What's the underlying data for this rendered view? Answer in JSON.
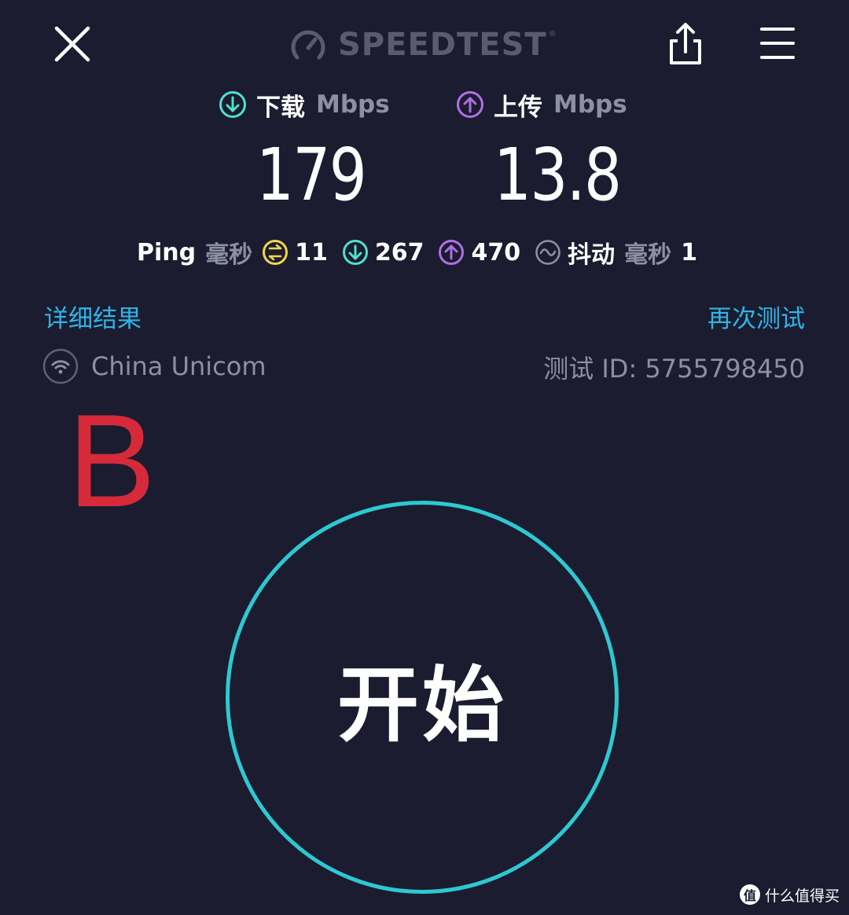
{
  "header": {
    "close_icon": "close-icon",
    "logo_text": "SPEEDTEST",
    "logo_tm": "®",
    "share_icon": "share-icon",
    "menu_icon": "menu-icon"
  },
  "download": {
    "icon": "arrow-down-circle-icon",
    "label": "下载",
    "unit": "Mbps",
    "value": "179",
    "accent": "#4fe0cf"
  },
  "upload": {
    "icon": "arrow-up-circle-icon",
    "label": "上传",
    "unit": "Mbps",
    "value": "13.8",
    "accent": "#b06ee8"
  },
  "ping_row": {
    "ping_label": "Ping",
    "ms_label": "毫秒",
    "idle_icon": "ping-idle-icon",
    "idle_value": "11",
    "idle_accent": "#f2d54a",
    "down_value": "267",
    "up_value": "470",
    "jitter_icon": "jitter-icon",
    "jitter_label": "抖动",
    "jitter_unit": "毫秒",
    "jitter_value": "1"
  },
  "links": {
    "details": "详细结果",
    "retest": "再次测试"
  },
  "provider": {
    "icon": "wifi-icon",
    "name": "China Unicom",
    "test_id": "测试 ID: 5755798450"
  },
  "annotation": {
    "letter": "B",
    "color": "#d62a3a"
  },
  "start": {
    "label": "开始",
    "ring_color": "#2ec8d2"
  },
  "watermark": {
    "badge": "值",
    "text": "什么值得买"
  }
}
